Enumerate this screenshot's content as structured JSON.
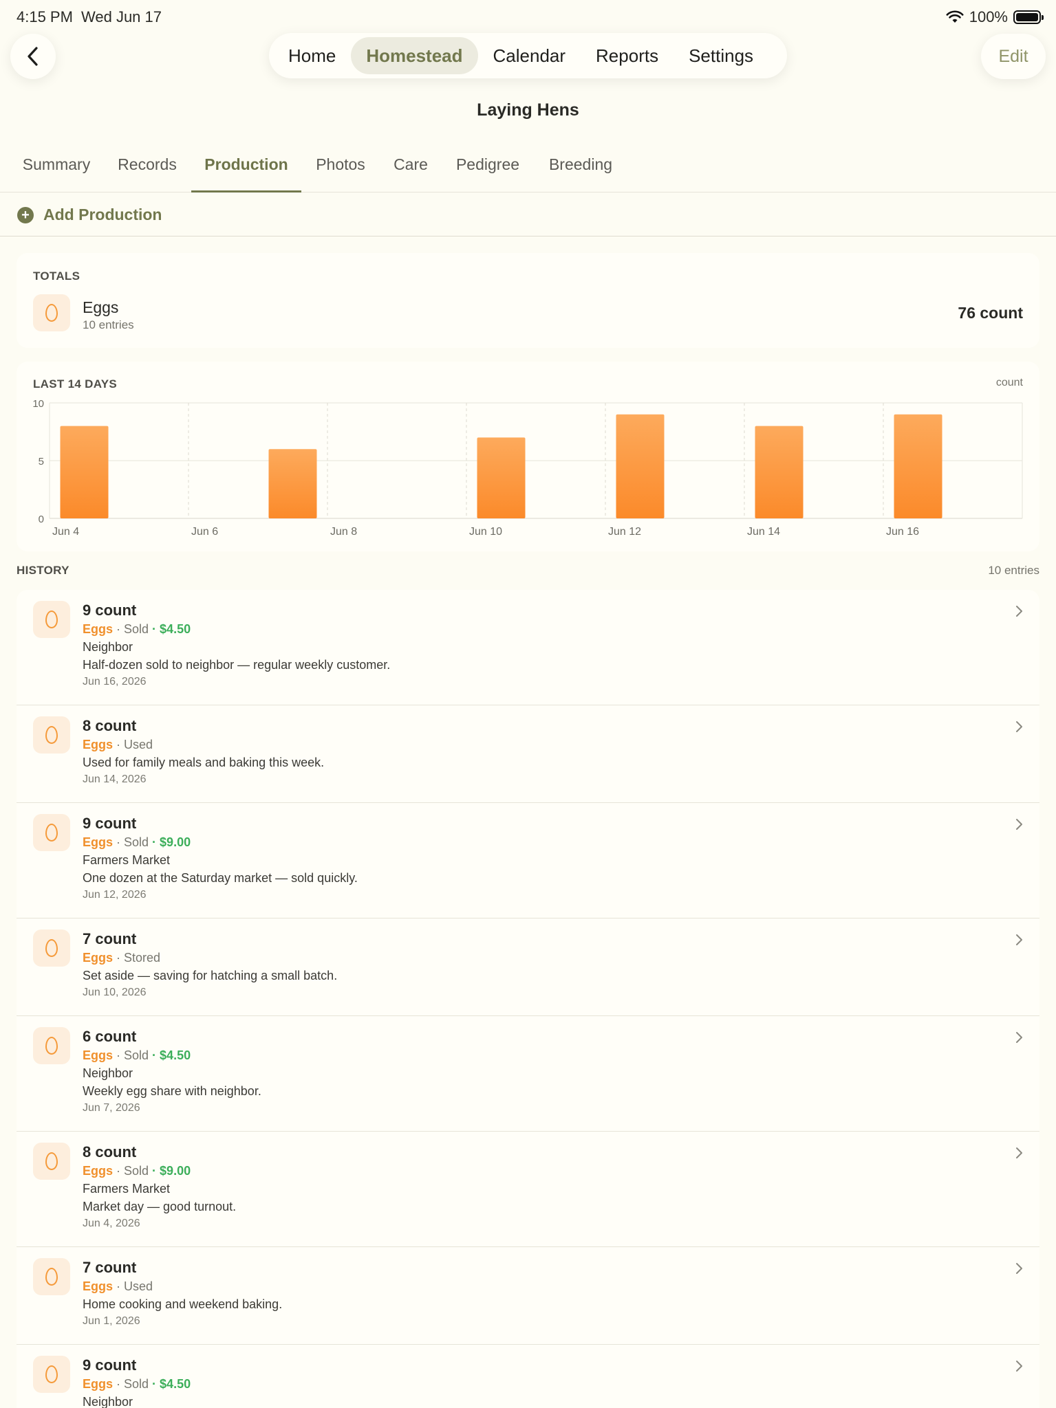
{
  "status": {
    "time": "4:15 PM",
    "date": "Wed Jun 17",
    "battery": "100%"
  },
  "nav": {
    "tabs": [
      "Home",
      "Homestead",
      "Calendar",
      "Reports",
      "Settings"
    ],
    "active": "Homestead",
    "edit_label": "Edit"
  },
  "page": {
    "title": "Laying Hens"
  },
  "subtabs": {
    "items": [
      "Summary",
      "Records",
      "Production",
      "Photos",
      "Care",
      "Pedigree",
      "Breeding"
    ],
    "active": "Production"
  },
  "add_label": "Add Production",
  "totals": {
    "label": "TOTALS",
    "name": "Eggs",
    "entries": "10 entries",
    "value": "76 count"
  },
  "chart_data": {
    "type": "bar",
    "title": "LAST 14 DAYS",
    "unit_label": "count",
    "x": [
      "Jun 4",
      "Jun 5",
      "Jun 6",
      "Jun 7",
      "Jun 8",
      "Jun 9",
      "Jun 10",
      "Jun 11",
      "Jun 12",
      "Jun 13",
      "Jun 14",
      "Jun 15",
      "Jun 16",
      "Jun 17"
    ],
    "values": [
      8,
      0,
      0,
      6,
      0,
      0,
      7,
      0,
      9,
      0,
      8,
      0,
      9,
      0
    ],
    "x_tick_labels": [
      "Jun 4",
      "Jun 6",
      "Jun 8",
      "Jun 10",
      "Jun 12",
      "Jun 14",
      "Jun 16"
    ],
    "y_ticks": [
      0,
      5,
      10
    ],
    "ylim": [
      0,
      10
    ],
    "bar_color": "#fb8a2a",
    "grid": true
  },
  "history": {
    "label": "HISTORY",
    "count": "10 entries",
    "items": [
      {
        "amount": "9 count",
        "category": "Eggs",
        "type": "Sold",
        "price": "$4.50",
        "buyer": "Neighbor",
        "note": "Half-dozen sold to neighbor — regular weekly customer.",
        "date": "Jun 16, 2026"
      },
      {
        "amount": "8 count",
        "category": "Eggs",
        "type": "Used",
        "price": "",
        "buyer": "",
        "note": "Used for family meals and baking this week.",
        "date": "Jun 14, 2026"
      },
      {
        "amount": "9 count",
        "category": "Eggs",
        "type": "Sold",
        "price": "$9.00",
        "buyer": "Farmers Market",
        "note": "One dozen at the Saturday market — sold quickly.",
        "date": "Jun 12, 2026"
      },
      {
        "amount": "7 count",
        "category": "Eggs",
        "type": "Stored",
        "price": "",
        "buyer": "",
        "note": "Set aside — saving for hatching a small batch.",
        "date": "Jun 10, 2026"
      },
      {
        "amount": "6 count",
        "category": "Eggs",
        "type": "Sold",
        "price": "$4.50",
        "buyer": "Neighbor",
        "note": "Weekly egg share with neighbor.",
        "date": "Jun 7, 2026"
      },
      {
        "amount": "8 count",
        "category": "Eggs",
        "type": "Sold",
        "price": "$9.00",
        "buyer": "Farmers Market",
        "note": "Market day — good turnout.",
        "date": "Jun 4, 2026"
      },
      {
        "amount": "7 count",
        "category": "Eggs",
        "type": "Used",
        "price": "",
        "buyer": "",
        "note": "Home cooking and weekend baking.",
        "date": "Jun 1, 2026"
      },
      {
        "amount": "9 count",
        "category": "Eggs",
        "type": "Sold",
        "price": "$4.50",
        "buyer": "Neighbor",
        "note": "",
        "date": ""
      }
    ]
  },
  "icons": {
    "back": "chevron-left-icon",
    "row": "egg-icon",
    "row_chevron": "chevron-right-icon",
    "add": "plus-circle-icon"
  },
  "colors": {
    "accent": "#72784d",
    "egg": "#f59a3a",
    "price": "#3cae5a",
    "background": "#fdfcf3"
  }
}
